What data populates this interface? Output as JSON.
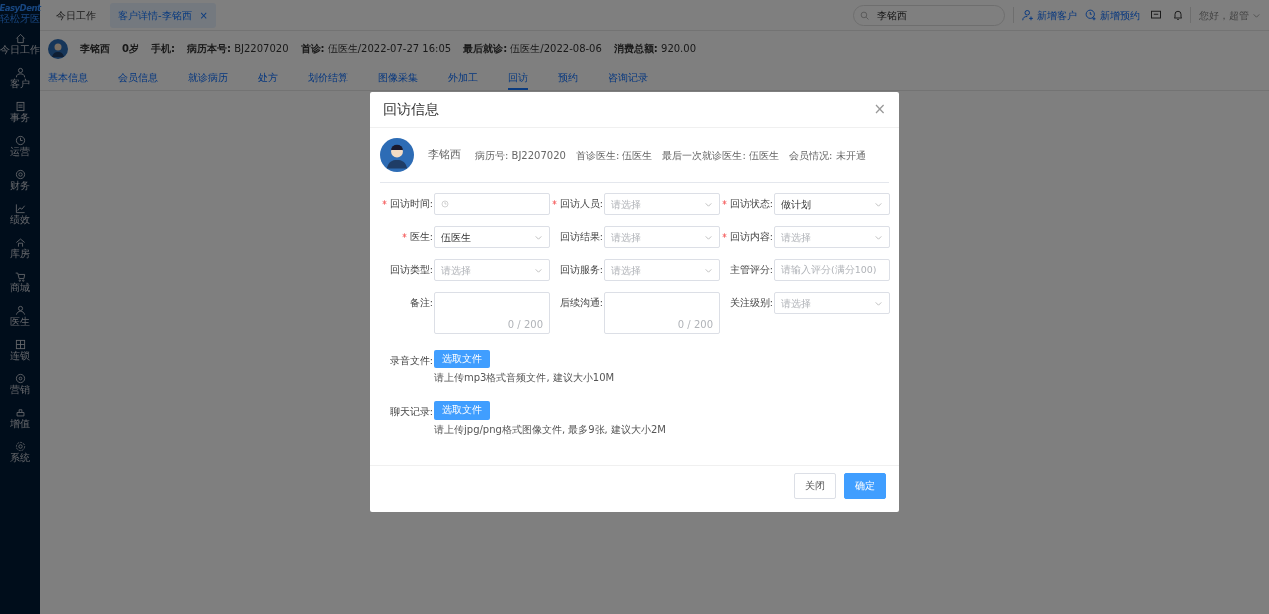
{
  "sidebar": {
    "logo": "EasyDent",
    "logo_sub": "轻松牙医",
    "items": [
      {
        "label": "今日工作",
        "selected": false
      },
      {
        "label": "客户",
        "selected": false
      },
      {
        "label": "事务",
        "selected": false
      },
      {
        "label": "运营",
        "selected": false
      },
      {
        "label": "财务",
        "selected": false
      },
      {
        "label": "绩效",
        "selected": false
      },
      {
        "label": "库房",
        "selected": false
      },
      {
        "label": "商城",
        "selected": false
      },
      {
        "label": "医生",
        "selected": false
      },
      {
        "label": "连锁",
        "selected": false
      },
      {
        "label": "营销",
        "selected": false
      },
      {
        "label": "增值",
        "selected": false
      },
      {
        "label": "系统",
        "selected": false
      }
    ]
  },
  "top_tabs": [
    {
      "label": "今日工作",
      "selected": false
    },
    {
      "label": "客户详情-李铭西",
      "selected": true,
      "close": "×"
    }
  ],
  "search": {
    "value": "李铭西"
  },
  "header_actions": [
    {
      "label": "新增客户",
      "kind": "user"
    },
    {
      "label": "新增预约",
      "kind": "clock"
    }
  ],
  "greeting": "您好，超管",
  "patient": {
    "name": "李铭西",
    "age": "0岁",
    "fields": [
      {
        "label": "手机:"
      },
      {
        "label": "病历本号:",
        "value": "BJ2207020"
      },
      {
        "label": "首诊:",
        "value": "伍医生/2022-07-27 16:05"
      },
      {
        "label": "最后就诊:",
        "value": "伍医生/2022-08-06"
      },
      {
        "label": "消费总额:",
        "value": "920.00"
      }
    ]
  },
  "detail_tabs": [
    {
      "label": "基本信息",
      "selected": false
    },
    {
      "label": "会员信息",
      "selected": false
    },
    {
      "label": "就诊病历",
      "selected": false
    },
    {
      "label": "处方",
      "selected": false
    },
    {
      "label": "划价结算",
      "selected": false
    },
    {
      "label": "图像采集",
      "selected": false
    },
    {
      "label": "外加工",
      "selected": false
    },
    {
      "label": "回访",
      "selected": true
    },
    {
      "label": "预约",
      "selected": false
    },
    {
      "label": "咨询记录",
      "selected": false
    }
  ],
  "dialog": {
    "title": "回访信息",
    "close": "×",
    "patient_name": "李铭西",
    "info": [
      "病历号: BJ2207020",
      "首诊医生: 伍医生",
      "最后一次就诊医生: 伍医生",
      "会员情况: 未开通"
    ],
    "fields": [
      {
        "label": "回访时间:",
        "required": true,
        "kind": "time"
      },
      {
        "label": "回访人员:",
        "required": true,
        "kind": "select",
        "placeholder": "请选择"
      },
      {
        "label": "回访状态:",
        "required": true,
        "kind": "select",
        "value": "做计划"
      },
      {
        "label": "医生:",
        "required": true,
        "kind": "select",
        "value": "伍医生"
      },
      {
        "label": "回访结果:",
        "required": false,
        "kind": "select",
        "placeholder": "请选择"
      },
      {
        "label": "回访内容:",
        "required": true,
        "kind": "select",
        "placeholder": "请选择"
      },
      {
        "label": "回访类型:",
        "required": false,
        "kind": "select",
        "placeholder": "请选择"
      },
      {
        "label": "回访服务:",
        "required": false,
        "kind": "select",
        "placeholder": "请选择"
      },
      {
        "label": "主管评分:",
        "required": false,
        "kind": "input",
        "placeholder": "请输入评分(满分100)"
      },
      {
        "label": "备注:",
        "required": false,
        "kind": "textarea",
        "counter": "0 / 200"
      },
      {
        "label": "后续沟通:",
        "required": false,
        "kind": "textarea",
        "counter": "0 / 200"
      },
      {
        "label": "关注级别:",
        "required": false,
        "kind": "select",
        "placeholder": "请选择"
      }
    ],
    "uploads": [
      {
        "label": "录音文件:",
        "button": "选取文件",
        "hint": "请上传mp3格式音频文件, 建议大小10M"
      },
      {
        "label": "聊天记录:",
        "button": "选取文件",
        "hint": "请上传jpg/png格式图像文件, 最多9张, 建议大小2M"
      }
    ],
    "buttons": [
      {
        "label": "关闭",
        "primary": false
      },
      {
        "label": "确定",
        "primary": true
      }
    ]
  }
}
